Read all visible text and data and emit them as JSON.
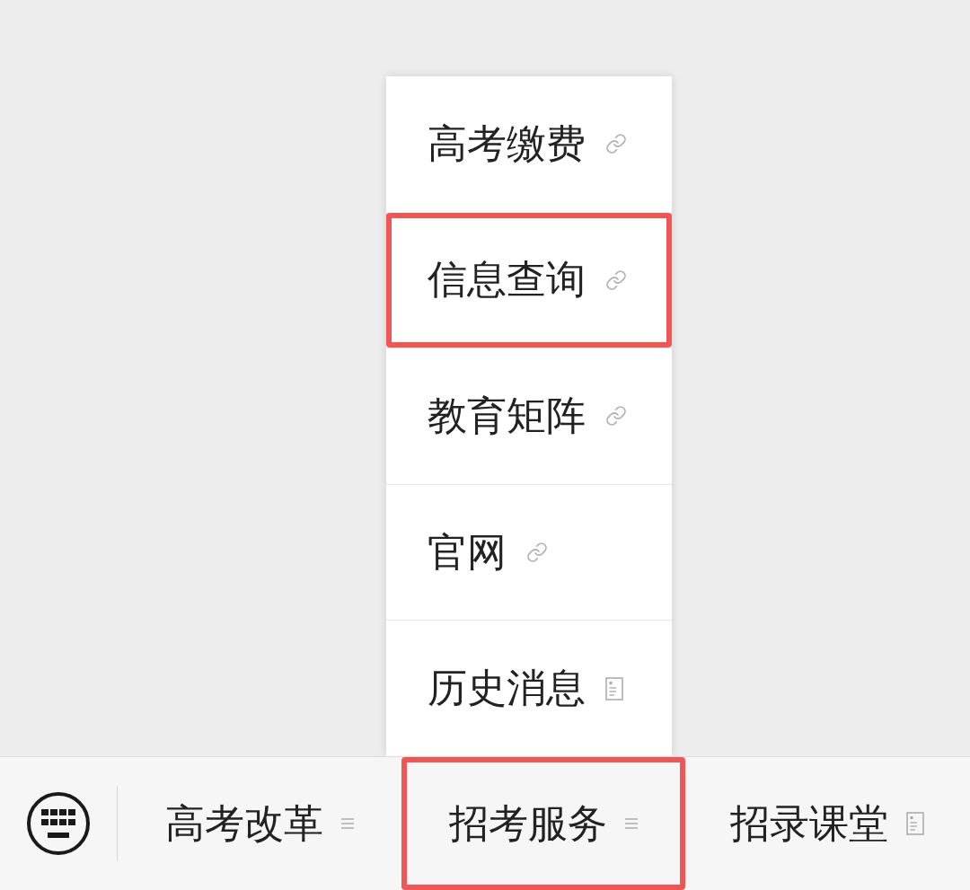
{
  "menu_items": [
    {
      "label": "高考缴费",
      "kind": "link",
      "highlighted": false
    },
    {
      "label": "信息查询",
      "kind": "link",
      "highlighted": true
    },
    {
      "label": "教育矩阵",
      "kind": "link",
      "highlighted": false
    },
    {
      "label": "官网",
      "kind": "link",
      "highlighted": false
    },
    {
      "label": "历史消息",
      "kind": "document",
      "highlighted": false
    }
  ],
  "bottom_tabs": [
    {
      "label": "高考改革",
      "kind": "list",
      "highlighted": false
    },
    {
      "label": "招考服务",
      "kind": "list",
      "highlighted": true
    },
    {
      "label": "招录课堂",
      "kind": "document",
      "highlighted": false
    }
  ]
}
